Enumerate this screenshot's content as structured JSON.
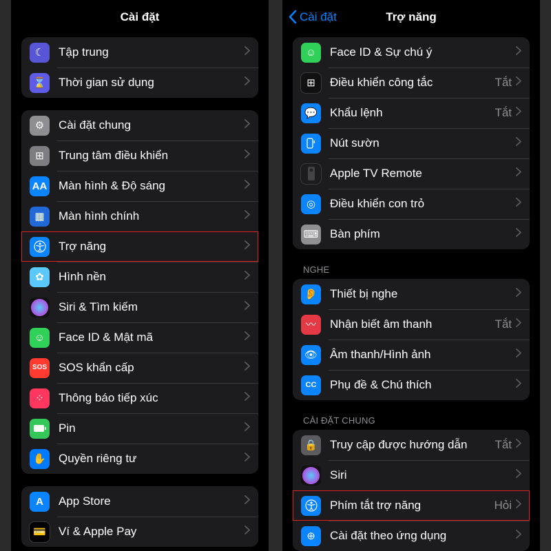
{
  "left": {
    "title": "Cài đặt",
    "groups": [
      {
        "rows": [
          {
            "id": "focus",
            "label": "Tập trung"
          },
          {
            "id": "screentime",
            "label": "Thời gian sử dụng"
          }
        ]
      },
      {
        "rows": [
          {
            "id": "general",
            "label": "Cài đặt chung"
          },
          {
            "id": "control-center",
            "label": "Trung tâm điều khiển"
          },
          {
            "id": "display",
            "label": "Màn hình & Độ sáng"
          },
          {
            "id": "home",
            "label": "Màn hình chính"
          },
          {
            "id": "accessibility",
            "label": "Trợ năng",
            "highlight": true
          },
          {
            "id": "wallpaper",
            "label": "Hình nền"
          },
          {
            "id": "siri",
            "label": "Siri & Tìm kiếm"
          },
          {
            "id": "faceid",
            "label": "Face ID & Mật mã"
          },
          {
            "id": "sos",
            "label": "SOS khẩn cấp"
          },
          {
            "id": "exposure",
            "label": "Thông báo tiếp xúc"
          },
          {
            "id": "battery",
            "label": "Pin"
          },
          {
            "id": "privacy",
            "label": "Quyền riêng tư"
          }
        ]
      },
      {
        "rows": [
          {
            "id": "appstore",
            "label": "App Store"
          },
          {
            "id": "wallet",
            "label": "Ví & Apple Pay"
          }
        ]
      }
    ]
  },
  "right": {
    "back": "Cài đặt",
    "title": "Trợ năng",
    "groups": [
      {
        "rows": [
          {
            "id": "face-attention",
            "label": "Face ID & Sự chú ý"
          },
          {
            "id": "switch-control",
            "label": "Điều khiển công tắc",
            "value": "Tắt"
          },
          {
            "id": "voice-control",
            "label": "Khẩu lệnh",
            "value": "Tắt"
          },
          {
            "id": "side-button",
            "label": "Nút sườn"
          },
          {
            "id": "tv-remote",
            "label": "Apple TV Remote"
          },
          {
            "id": "pointer",
            "label": "Điều khiển con trỏ"
          },
          {
            "id": "keyboard",
            "label": "Bàn phím"
          }
        ]
      },
      {
        "label": "NGHE",
        "rows": [
          {
            "id": "hearing",
            "label": "Thiết bị nghe"
          },
          {
            "id": "sound-recog",
            "label": "Nhận biết âm thanh",
            "value": "Tắt"
          },
          {
            "id": "audio-visual",
            "label": "Âm thanh/Hình ảnh"
          },
          {
            "id": "subtitles",
            "label": "Phụ đề & Chú thích"
          }
        ]
      },
      {
        "label": "CÀI ĐẶT CHUNG",
        "rows": [
          {
            "id": "guided",
            "label": "Truy cập được hướng dẫn",
            "value": "Tắt"
          },
          {
            "id": "siri-acc",
            "label": "Siri"
          },
          {
            "id": "shortcut",
            "label": "Phím tắt trợ năng",
            "value": "Hỏi",
            "highlight": true
          },
          {
            "id": "perapp",
            "label": "Cài đặt theo ứng dụng"
          }
        ]
      }
    ]
  }
}
